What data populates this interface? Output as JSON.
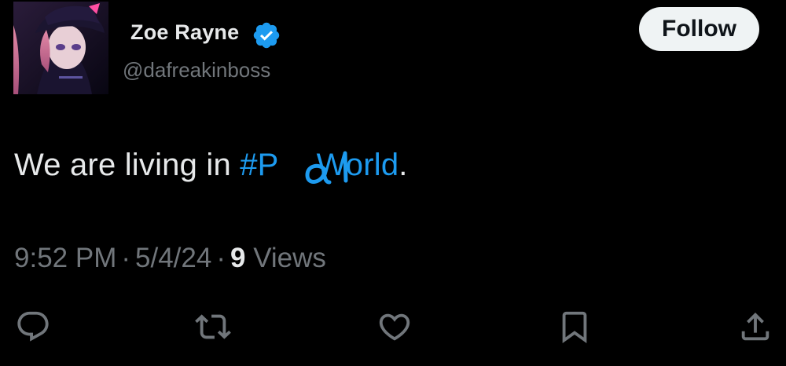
{
  "author": {
    "display_name": "Zoe Rayne",
    "handle": "@dafreakinboss",
    "verified": true
  },
  "follow_button": {
    "label": "Follow"
  },
  "tweet": {
    "text_before": "We are living in ",
    "hashtag_start": "#P",
    "handwritten_overlay": "al",
    "hashtag_end": "World",
    "text_after": "."
  },
  "meta": {
    "time": "9:52 PM",
    "separator": "·",
    "date": "5/4/24",
    "views_count": "9",
    "views_label": "Views"
  },
  "actions": [
    "reply-icon",
    "retweet-icon",
    "like-icon",
    "bookmark-icon",
    "share-icon"
  ],
  "colors": {
    "background": "#000000",
    "primary_text": "#e7e9ea",
    "secondary_text": "#71767b",
    "link": "#1d9bf0",
    "verified": "#1d9bf0",
    "follow_button_bg": "#eff3f4"
  }
}
